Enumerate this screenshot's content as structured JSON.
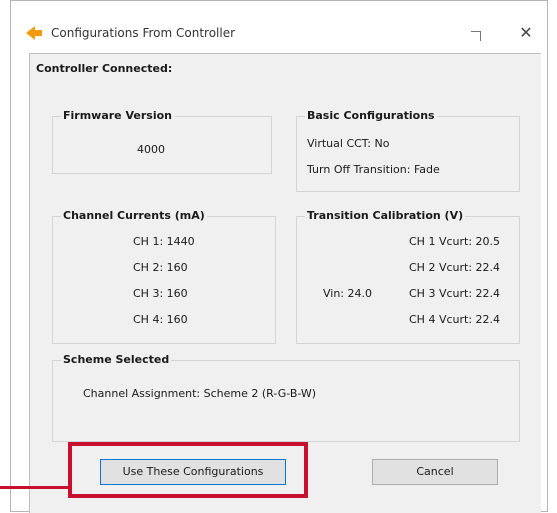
{
  "window": {
    "title": "Configurations From Controller",
    "icon": "orange-arrow-icon",
    "close_glyph": "✕"
  },
  "status": "Controller Connected:",
  "firmware": {
    "legend": "Firmware Version",
    "value": "4000"
  },
  "basic": {
    "legend": "Basic Configurations",
    "virtual_cct": "Virtual CCT:    No",
    "turn_off": "Turn Off Transition:   Fade"
  },
  "currents": {
    "legend": "Channel Currents (mA)",
    "items": [
      "CH 1:  1440",
      "CH 2:  160",
      "CH 3:  160",
      "CH 4:  160"
    ]
  },
  "calibration": {
    "legend": "Transition Calibration (V)",
    "vin": "Vin:  24.0",
    "items": [
      "CH 1 Vcurt:  20.5",
      "CH 2 Vcurt:  22.4",
      "CH 3 Vcurt:  22.4",
      "CH 4 Vcurt:  22.4"
    ]
  },
  "scheme": {
    "legend": "Scheme Selected",
    "assignment": "Channel Assignment:    Scheme 2 (R-G-B-W)"
  },
  "buttons": {
    "use": "Use These Configurations",
    "cancel": "Cancel"
  },
  "colors": {
    "callout": "#c8102e",
    "accent_border": "#0078d7",
    "icon": "#f39c12"
  }
}
